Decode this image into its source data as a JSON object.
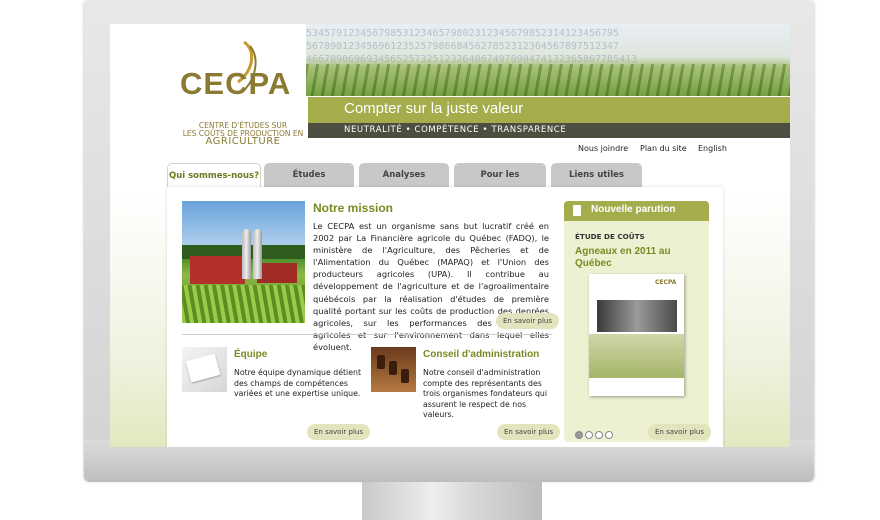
{
  "header": {
    "logo_text": "CECPA",
    "logo_tagline_1": "CENTRE D'ÉTUDES SUR",
    "logo_tagline_2": "LES COÛTS DE PRODUCTION EN",
    "logo_tagline_3": "AGRICULTURE",
    "hero_digits_1": "5345791234567985312346579802312345679852314123456795",
    "hero_digits_2": "5678901234569612352579866845627852312364567897512347",
    "hero_digits_3": "4667890696934565257325123264867497090474132365867785413",
    "tagline": "Compter sur la juste valeur",
    "subtag": "NEUTRALITÉ • COMPÉTENCE • TRANSPARENCE"
  },
  "toplinks": [
    "Nous joindre",
    "Plan du site",
    "English"
  ],
  "tabs": [
    "Qui sommes-nous?",
    "Études",
    "Analyses",
    "Pour les participants",
    "Liens utiles"
  ],
  "mission": {
    "title": "Notre mission",
    "text": "Le CECPA est un organisme sans but lucratif créé en 2002 par La Financière agricole du Québec (FADQ), le ministère de l'Agriculture, des Pêcheries et de l'Alimentation du Québec (MAPAQ) et l'Union des producteurs agricoles (UPA). Il contribue au développement de l'agriculture et de l'agroalimentaire québécois par la réalisation d'études de première qualité portant sur les coûts de production des denrées agricoles, sur les performances des entreprises agricoles et sur l'environnement dans lequel elles évoluent.",
    "more": "En savoir plus"
  },
  "equipe": {
    "title": "Équipe",
    "text": "Notre équipe dynamique détient des champs de compétences variées et une expertise unique.",
    "more": "En savoir plus"
  },
  "conseil": {
    "title": "Conseil d'administration",
    "text": "Notre conseil d'administration compte des représentants des trois organismes fondateurs qui assurent le respect de nos valeurs.",
    "more": "En savoir plus"
  },
  "sidebar": {
    "head": "Nouvelle parution",
    "sub": "ÉTUDE DE COÛTS",
    "title": "Agneaux en 2011 au Québec",
    "cover_logo": "CECPA",
    "more": "En savoir plus",
    "carousel_active": 1
  },
  "colors": {
    "accent": "#a5ac4c",
    "title_green": "#7a8a22",
    "dark_band": "#4d4d40"
  }
}
